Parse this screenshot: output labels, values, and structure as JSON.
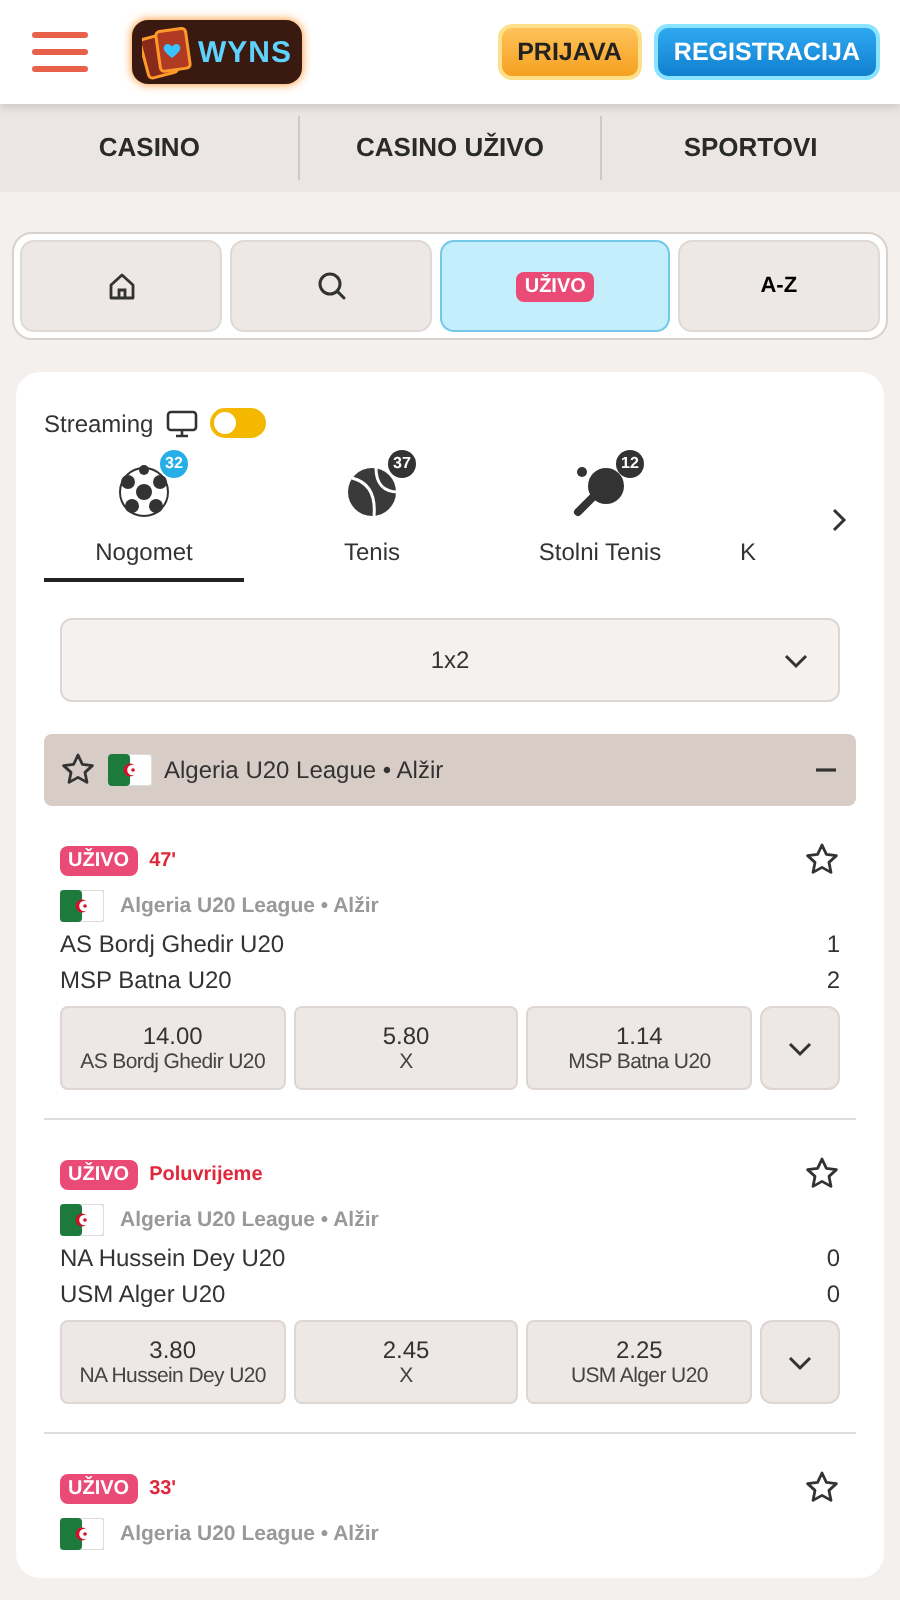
{
  "header": {
    "logo": "WYNS",
    "login": "PRIJAVA",
    "register": "REGISTRACIJA"
  },
  "nav": [
    "CASINO",
    "CASINO UŽIVO",
    "SPORTOVI"
  ],
  "quick_tabs": [
    {
      "kind": "home",
      "selected": false
    },
    {
      "kind": "search",
      "selected": false
    },
    {
      "kind": "live",
      "label": "UŽIVO",
      "selected": true
    },
    {
      "kind": "text",
      "label": "A-Z",
      "selected": false
    }
  ],
  "streaming": {
    "label": "Streaming",
    "on": false
  },
  "sports": [
    {
      "kind": "soccer",
      "label": "Nogomet",
      "count": "32",
      "selected": true
    },
    {
      "kind": "tennis",
      "label": "Tenis",
      "count": "37",
      "selected": false
    },
    {
      "kind": "pingpong",
      "label": "Stolni Tenis",
      "count": "12",
      "selected": false
    },
    {
      "kind": "other",
      "label": "K",
      "selected": false
    }
  ],
  "market": "1x2",
  "league": {
    "name": "Algeria U20 League • Alžir",
    "favorite": false,
    "expanded": true
  },
  "matches": [
    {
      "status": "UŽIVO",
      "time": "47'",
      "favorite": false,
      "league": "Algeria U20 League • Alžir",
      "home": "AS Bordj Ghedir U20",
      "away": "MSP Batna U20",
      "home_score": "1",
      "away_score": "2",
      "odds": [
        {
          "value": "14.00",
          "label": "AS Bordj Ghedir U20"
        },
        {
          "value": "5.80",
          "label": "X"
        },
        {
          "value": "1.14",
          "label": "MSP Batna U20"
        }
      ]
    },
    {
      "status": "UŽIVO",
      "time": "Poluvrijeme",
      "favorite": false,
      "league": "Algeria U20 League • Alžir",
      "home": "NA Hussein Dey U20",
      "away": "USM Alger U20",
      "home_score": "0",
      "away_score": "0",
      "odds": [
        {
          "value": "3.80",
          "label": "NA Hussein Dey U20"
        },
        {
          "value": "2.45",
          "label": "X"
        },
        {
          "value": "2.25",
          "label": "USM Alger U20"
        }
      ]
    },
    {
      "status": "UŽIVO",
      "time": "33'",
      "favorite": false,
      "league": "Algeria U20 League • Alžir"
    }
  ]
}
